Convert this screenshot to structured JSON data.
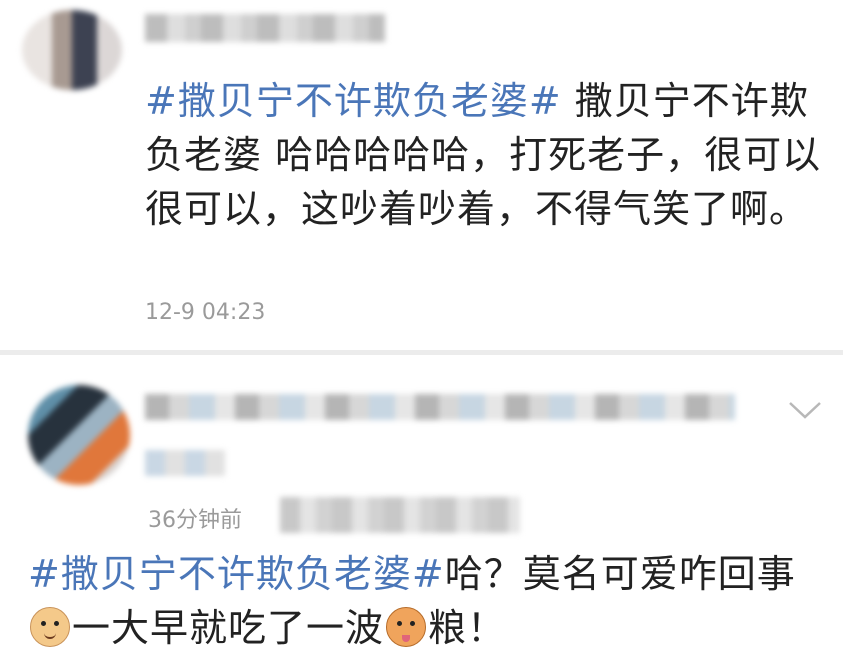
{
  "post1": {
    "topic": "#撒贝宁不许欺负老婆#",
    "text": "撒贝宁不许欺负老婆 哈哈哈哈哈，打死老子，很可以很可以，这吵着吵着，不得气笑了啊。",
    "time": "12-9 04:23"
  },
  "post2": {
    "time": "36分钟前",
    "topic": "#撒贝宁不许欺负老婆#",
    "text_a": "哈？莫名可爱咋回事",
    "text_b": "一大早就吃了一波",
    "text_c": "粮！",
    "emoji_1": "doge-emoji",
    "emoji_2": "shiba-emoji",
    "expand_icon": "chevron-down-icon"
  },
  "colors": {
    "topic": "#4a76b8",
    "text": "#222222",
    "meta": "#9a9a9a"
  }
}
